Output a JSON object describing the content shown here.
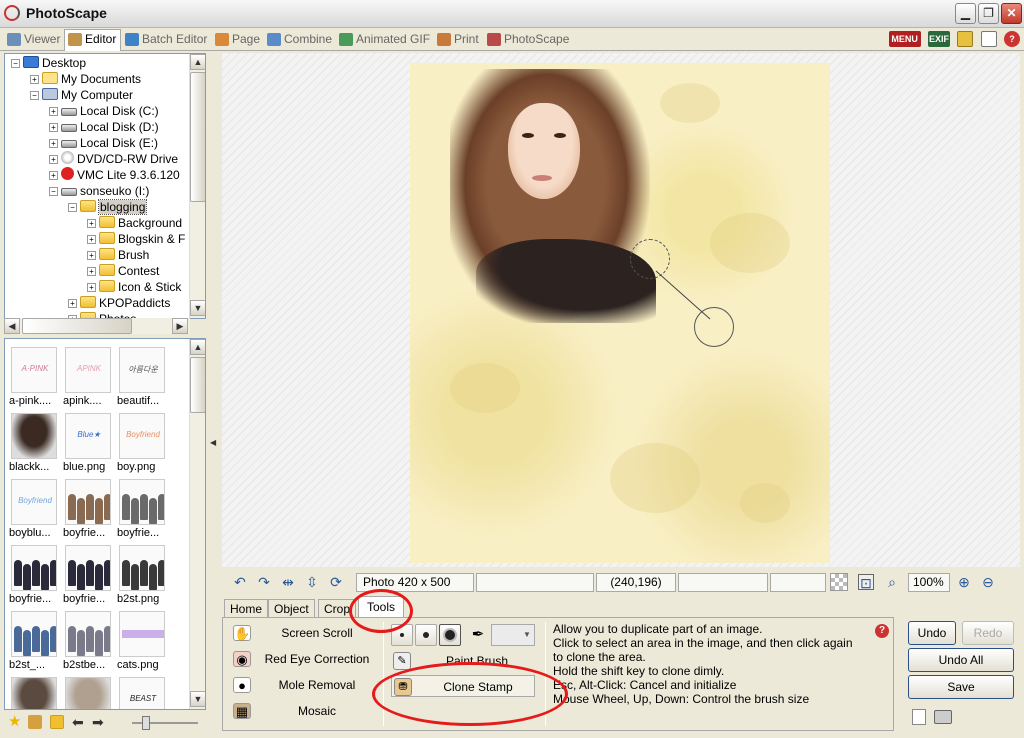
{
  "window": {
    "title": "PhotoScape",
    "min_symbol": "▁",
    "max_symbol": "❐",
    "close_symbol": "✕"
  },
  "tabs": [
    {
      "label": "Viewer",
      "color": "#6a8fb8"
    },
    {
      "label": "Editor",
      "color": "#c0944a"
    },
    {
      "label": "Batch Editor",
      "color": "#3e82c7"
    },
    {
      "label": "Page",
      "color": "#d88a3a"
    },
    {
      "label": "Combine",
      "color": "#5b8bc9"
    },
    {
      "label": "Animated GIF",
      "color": "#4a9a5a"
    },
    {
      "label": "Print",
      "color": "#c97a3a"
    },
    {
      "label": "PhotoScape",
      "color": "#b84a4a"
    }
  ],
  "top_icons": {
    "menu": "MENU",
    "exif": "EXIF",
    "help": "?"
  },
  "tree": [
    {
      "label": "Desktop",
      "icon": "desk",
      "level": 0,
      "exp": "−"
    },
    {
      "label": "My Documents",
      "icon": "docs",
      "level": 1,
      "exp": "+"
    },
    {
      "label": "My Computer",
      "icon": "comp",
      "level": 1,
      "exp": "−"
    },
    {
      "label": "Local Disk (C:)",
      "icon": "disk",
      "level": 2,
      "exp": "+"
    },
    {
      "label": "Local Disk (D:)",
      "icon": "disk",
      "level": 2,
      "exp": "+"
    },
    {
      "label": "Local Disk (E:)",
      "icon": "disk",
      "level": 2,
      "exp": "+"
    },
    {
      "label": "DVD/CD-RW Drive",
      "icon": "cd",
      "level": 2,
      "exp": "+"
    },
    {
      "label": "VMC Lite 9.3.6.120",
      "icon": "vmc",
      "level": 2,
      "exp": "+"
    },
    {
      "label": "sonseuko (I:)",
      "icon": "disk",
      "level": 2,
      "exp": "−"
    },
    {
      "label": "blogging",
      "icon": "folder",
      "level": 3,
      "exp": "−",
      "selected": true
    },
    {
      "label": "Background",
      "icon": "folder",
      "level": 4,
      "exp": "+"
    },
    {
      "label": "Blogskin & F",
      "icon": "folder",
      "level": 4,
      "exp": "+"
    },
    {
      "label": "Brush",
      "icon": "folder",
      "level": 4,
      "exp": "+"
    },
    {
      "label": "Contest",
      "icon": "folder",
      "level": 4,
      "exp": "+"
    },
    {
      "label": "Icon & Stick",
      "icon": "folder",
      "level": 4,
      "exp": "+"
    },
    {
      "label": "KPOPaddicts",
      "icon": "folder",
      "level": 3,
      "exp": "+"
    },
    {
      "label": "Photos",
      "icon": "folder",
      "level": 3,
      "exp": "+"
    }
  ],
  "thumbnails": [
    {
      "name": "a-pink....",
      "art": "text",
      "color": "#d07a9a",
      "text": "A·PINK"
    },
    {
      "name": "apink....",
      "art": "text",
      "color": "#e6a0b0",
      "text": "APINK"
    },
    {
      "name": "beautif...",
      "art": "text",
      "color": "#555",
      "text": "아름다운"
    },
    {
      "name": "blackk...",
      "art": "person",
      "color": "#3a2a22"
    },
    {
      "name": "blue.png",
      "art": "text",
      "color": "#3b6fc9",
      "text": "Blue★"
    },
    {
      "name": "boy.png",
      "art": "text",
      "color": "#e89060",
      "text": "Boyfriend"
    },
    {
      "name": "boyblu...",
      "art": "text",
      "color": "#6ea8e0",
      "text": "Boyfriend"
    },
    {
      "name": "boyfrie...",
      "art": "group",
      "color": "#8a6a50"
    },
    {
      "name": "boyfrie...",
      "art": "group",
      "color": "#6a6a6a"
    },
    {
      "name": "boyfrie...",
      "art": "group",
      "color": "#2a2a3a"
    },
    {
      "name": "boyfrie...",
      "art": "group",
      "color": "#2a2a3a"
    },
    {
      "name": "b2st.png",
      "art": "group",
      "color": "#3a3a3a"
    },
    {
      "name": "b2st_...",
      "art": "group",
      "color": "#4a6a9a"
    },
    {
      "name": "b2stbe...",
      "art": "group",
      "color": "#7a7a8a"
    },
    {
      "name": "cats.png",
      "art": "strip",
      "color": "#c9b0e8"
    },
    {
      "name": "",
      "art": "person",
      "color": "#5a4a40"
    },
    {
      "name": "",
      "art": "person",
      "color": "#b0a090"
    },
    {
      "name": "",
      "art": "text",
      "color": "#222",
      "text": "BEAST"
    }
  ],
  "status": {
    "photo_info": "Photo 420 x 500",
    "coords": "(240,196)",
    "zoom": "100%"
  },
  "editor_tabs": [
    "Home",
    "Object",
    "Crop",
    "Tools"
  ],
  "tools": [
    {
      "label": "Screen Scroll",
      "icon": "✋",
      "color": "#ffffff"
    },
    {
      "label": "Red Eye Correction",
      "icon": "◉",
      "color": "#f4d0c8"
    },
    {
      "label": "Mole Removal",
      "icon": "●",
      "color": "#ffffff"
    },
    {
      "label": "Mosaic",
      "icon": "▦",
      "color": "#c8b08a"
    }
  ],
  "subtools": [
    {
      "label": "Paint Brush",
      "icon": "✎"
    },
    {
      "label": "Clone Stamp",
      "icon": "⛃"
    }
  ],
  "help_lines": [
    "Allow you to duplicate part of an image.",
    "Click to select an area in the image, and then click again",
    "to clone the area.",
    "Hold the shift key to clone dimly.",
    "Esc, Alt-Click: Cancel and initialize",
    "Mouse Wheel, Up, Down: Control the brush size"
  ],
  "buttons": {
    "undo": "Undo",
    "redo": "Redo",
    "undo_all": "Undo All",
    "save": "Save"
  },
  "colors": {
    "annotation_red": "#e51b1b",
    "selection_blue": "#2a4f8a"
  }
}
